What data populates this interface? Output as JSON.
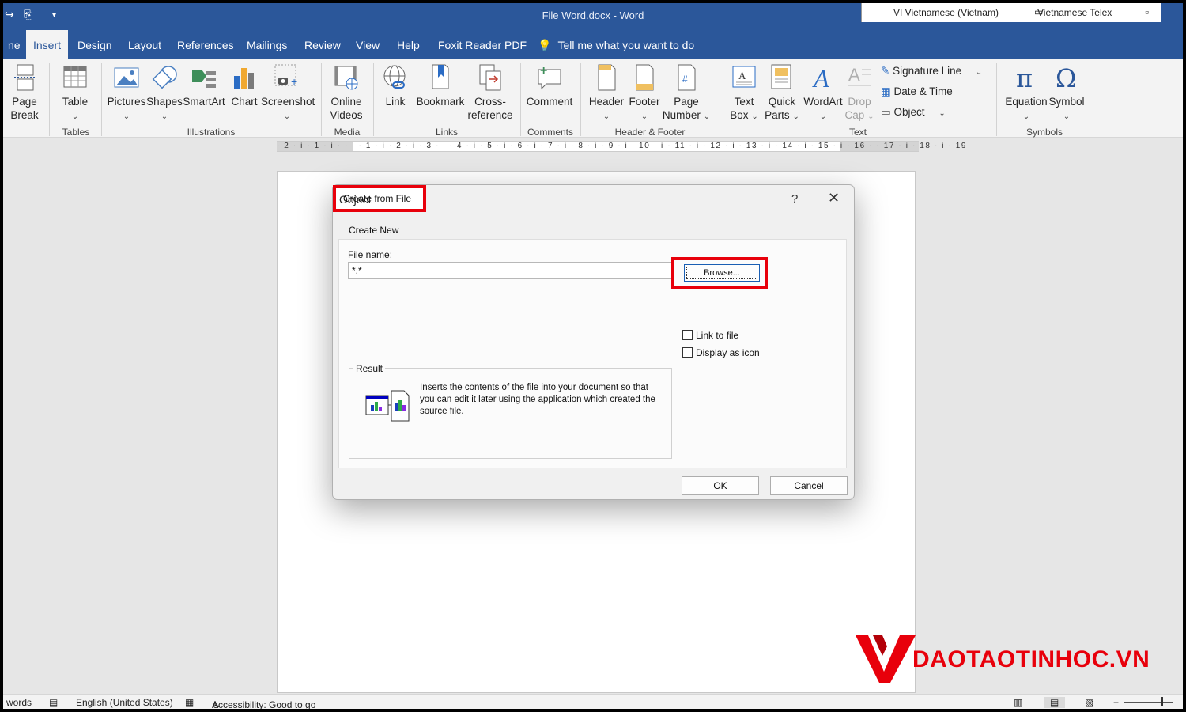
{
  "window": {
    "title": "File Word.docx  -  Word"
  },
  "ime": {
    "language": "VI  Vietnamese (Vietnam)",
    "input_method": "Vietnamese Telex"
  },
  "ribbon_tabs": [
    "ne",
    "Insert",
    "Design",
    "Layout",
    "References",
    "Mailings",
    "Review",
    "View",
    "Help",
    "Foxit Reader PDF"
  ],
  "active_tab": "Insert",
  "tell_me": "Tell me what you want to do",
  "ribbon": {
    "page_break": [
      "Page",
      "Break"
    ],
    "table": "Table",
    "pictures": "Pictures",
    "shapes": "Shapes",
    "smartart": "SmartArt",
    "chart": "Chart",
    "screenshot": "Screenshot",
    "online_videos": [
      "Online",
      "Videos"
    ],
    "link": "Link",
    "bookmark": "Bookmark",
    "cross_reference": [
      "Cross-",
      "reference"
    ],
    "comment": "Comment",
    "header": "Header",
    "footer": "Footer",
    "page_number": [
      "Page",
      "Number"
    ],
    "text_box": [
      "Text",
      "Box"
    ],
    "quick_parts": [
      "Quick",
      "Parts"
    ],
    "wordart": "WordArt",
    "drop_cap": [
      "Drop",
      "Cap"
    ],
    "signature_line": "Signature Line",
    "date_time": "Date & Time",
    "object": "Object",
    "equation": "Equation",
    "symbol": "Symbol",
    "groups": {
      "tables": "Tables",
      "illustrations": "Illustrations",
      "media": "Media",
      "links": "Links",
      "comments": "Comments",
      "header_footer": "Header & Footer",
      "text": "Text",
      "symbols": "Symbols"
    }
  },
  "ruler": "· 2 · i · 1 · i ·   · i · 1 · i · 2 · i · 3 · i · 4 · i · 5 · i · 6 · i · 7 · i · 8 · i · 9 · i · 10 · i · 11 · i · 12 · i · 13 · i · 14 · i · 15 · i · 16 ·  · 17 · i · 18 · i · 19",
  "dialog": {
    "title": "Object",
    "help": "?",
    "tabs": [
      "Create New",
      "Create from File"
    ],
    "active_tab": "Create from File",
    "file_name_label": "File name:",
    "file_name_value": "*.*",
    "browse": "Browse...",
    "link_to_file": "Link to file",
    "display_as_icon": "Display as icon",
    "result_label": "Result",
    "result_text": "Inserts the contents of the file into your document so that you can edit it later using the application which created the source file.",
    "ok": "OK",
    "cancel": "Cancel"
  },
  "watermark": "DAOTAOTINHOC.VN",
  "status": {
    "words": "words",
    "language": "English (United States)",
    "accessibility": "Accessibility: Good to go"
  },
  "colors": {
    "word_blue": "#2b579a",
    "highlight_red": "#e8000b"
  }
}
